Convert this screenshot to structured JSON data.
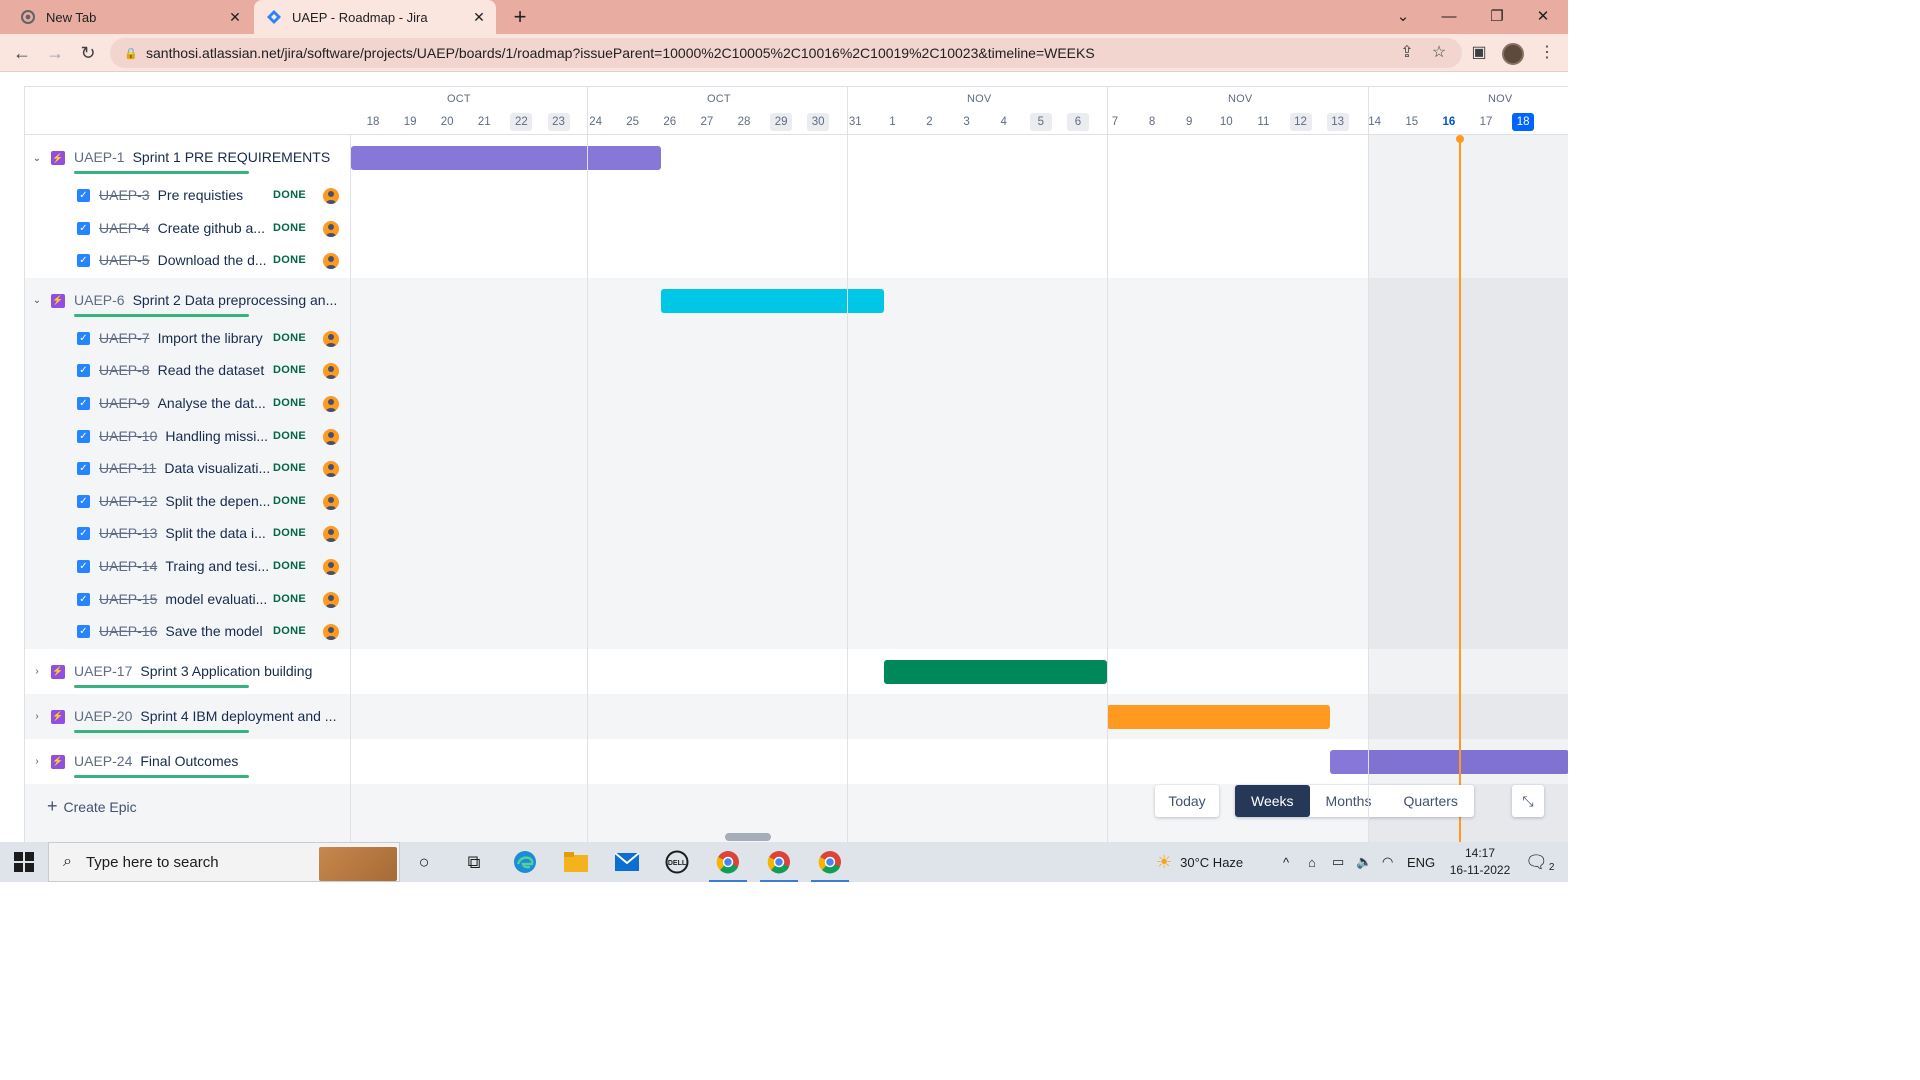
{
  "browser": {
    "tabs": [
      {
        "title": "New Tab",
        "icon": "chrome-icon",
        "active": false
      },
      {
        "title": "UAEP - Roadmap - Jira",
        "icon": "jira-icon",
        "active": true
      }
    ],
    "url": "santhosi.atlassian.net/jira/software/projects/UAEP/boards/1/roadmap?issueParent=10000%2C10005%2C10016%2C10019%2C10023&timeline=WEEKS"
  },
  "timeline": {
    "months": [
      "OCT",
      "OCT",
      "NOV",
      "NOV",
      "NOV"
    ],
    "days": [
      {
        "d": "18"
      },
      {
        "d": "19"
      },
      {
        "d": "20"
      },
      {
        "d": "21"
      },
      {
        "d": "22",
        "weekend": true
      },
      {
        "d": "23",
        "weekend": true
      },
      {
        "d": "24"
      },
      {
        "d": "25"
      },
      {
        "d": "26"
      },
      {
        "d": "27"
      },
      {
        "d": "28"
      },
      {
        "d": "29",
        "weekend": true
      },
      {
        "d": "30",
        "weekend": true
      },
      {
        "d": "31"
      },
      {
        "d": "1"
      },
      {
        "d": "2"
      },
      {
        "d": "3"
      },
      {
        "d": "4"
      },
      {
        "d": "5",
        "weekend": true
      },
      {
        "d": "6",
        "weekend": true
      },
      {
        "d": "7"
      },
      {
        "d": "8"
      },
      {
        "d": "9"
      },
      {
        "d": "10"
      },
      {
        "d": "11"
      },
      {
        "d": "12",
        "weekend": true
      },
      {
        "d": "13",
        "weekend": true
      },
      {
        "d": "14"
      },
      {
        "d": "15"
      },
      {
        "d": "16",
        "today": true
      },
      {
        "d": "17"
      },
      {
        "d": "18",
        "selected": true
      }
    ]
  },
  "epics": [
    {
      "key": "UAEP-1",
      "summary": "Sprint 1 PRE REQUIREMENTS",
      "expanded": true,
      "bar_color": "#8777d9",
      "children": [
        {
          "key": "UAEP-3",
          "summary": "Pre requisties",
          "status": "DONE"
        },
        {
          "key": "UAEP-4",
          "summary": "Create github a...",
          "status": "DONE"
        },
        {
          "key": "UAEP-5",
          "summary": "Download the d...",
          "status": "DONE"
        }
      ]
    },
    {
      "key": "UAEP-6",
      "summary": "Sprint 2 Data preprocessing an...",
      "expanded": true,
      "bar_color": "#00c7e6",
      "children": [
        {
          "key": "UAEP-7",
          "summary": "Import the library",
          "status": "DONE"
        },
        {
          "key": "UAEP-8",
          "summary": "Read the dataset",
          "status": "DONE"
        },
        {
          "key": "UAEP-9",
          "summary": "Analyse the dat...",
          "status": "DONE"
        },
        {
          "key": "UAEP-10",
          "summary": "Handling missi...",
          "status": "DONE"
        },
        {
          "key": "UAEP-11",
          "summary": "Data visualizati...",
          "status": "DONE"
        },
        {
          "key": "UAEP-12",
          "summary": "Split the depen...",
          "status": "DONE"
        },
        {
          "key": "UAEP-13",
          "summary": "Split the data i...",
          "status": "DONE"
        },
        {
          "key": "UAEP-14",
          "summary": "Traing and tesi...",
          "status": "DONE"
        },
        {
          "key": "UAEP-15",
          "summary": "model evaluati...",
          "status": "DONE"
        },
        {
          "key": "UAEP-16",
          "summary": "Save the model",
          "status": "DONE"
        }
      ]
    },
    {
      "key": "UAEP-17",
      "summary": "Sprint 3 Application building",
      "expanded": false,
      "bar_color": "#00875a",
      "children": []
    },
    {
      "key": "UAEP-20",
      "summary": "Sprint 4 IBM deployment and ...",
      "expanded": false,
      "bar_color": "#ff991f",
      "children": []
    },
    {
      "key": "UAEP-24",
      "summary": "Final Outcomes",
      "expanded": false,
      "bar_color": "#8777d9",
      "children": []
    }
  ],
  "create_epic": "Create Epic",
  "view_controls": {
    "today": "Today",
    "scales": [
      "Weeks",
      "Months",
      "Quarters"
    ],
    "active_scale": "Weeks"
  },
  "taskbar": {
    "search_placeholder": "Type here to search",
    "weather": "30°C  Haze",
    "language": "ENG",
    "time": "14:17",
    "date": "16-11-2022",
    "notifications": "2"
  }
}
